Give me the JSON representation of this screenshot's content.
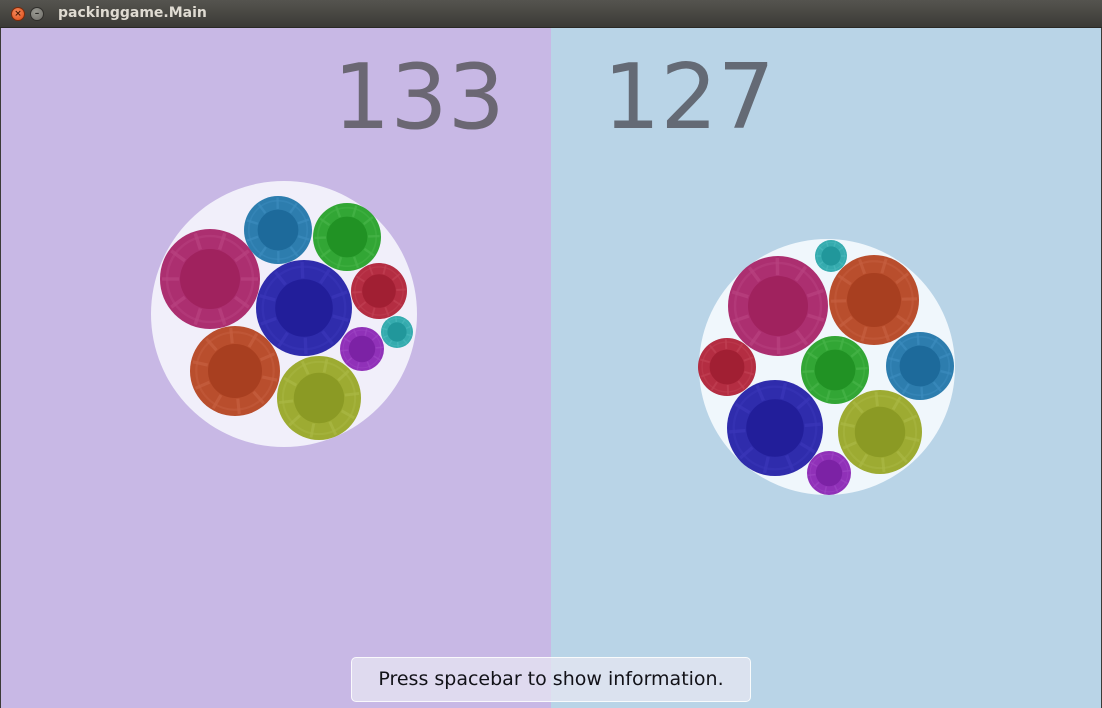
{
  "window": {
    "title": "packinggame.Main",
    "close_glyph": "×",
    "minimize_glyph": "–"
  },
  "colors": {
    "left_panel_bg": "#c8b8e5",
    "right_panel_bg": "#b9d4e7",
    "left_container": "#f1effa",
    "right_container": "#f0f7fc",
    "score_text": "#6b6773"
  },
  "players": [
    {
      "side": "left",
      "score": "133",
      "discs": [
        {
          "color": "magenta"
        },
        {
          "color": "blue"
        },
        {
          "color": "green"
        },
        {
          "color": "indigo"
        },
        {
          "color": "crimson"
        },
        {
          "color": "teal"
        },
        {
          "color": "purple"
        },
        {
          "color": "orange-red"
        },
        {
          "color": "olive"
        }
      ]
    },
    {
      "side": "right",
      "score": "127",
      "discs": [
        {
          "color": "teal"
        },
        {
          "color": "magenta"
        },
        {
          "color": "orange-red"
        },
        {
          "color": "crimson"
        },
        {
          "color": "green"
        },
        {
          "color": "blue"
        },
        {
          "color": "indigo"
        },
        {
          "color": "olive"
        },
        {
          "color": "purple"
        }
      ]
    }
  ],
  "hint_text": "Press spacebar to show information."
}
